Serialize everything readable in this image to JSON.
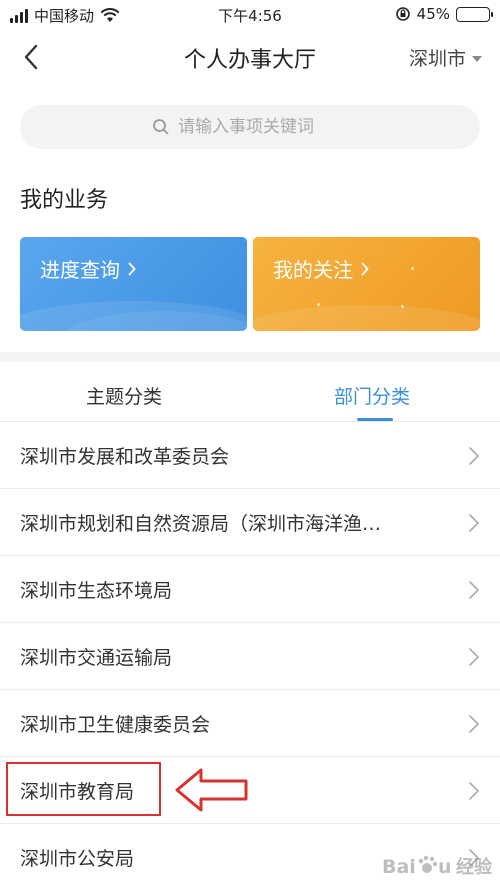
{
  "status_bar": {
    "carrier": "中国移动",
    "time": "下午4:56",
    "battery": "45%",
    "battery_level": 0.45
  },
  "nav": {
    "title": "个人办事大厅",
    "city": "深圳市"
  },
  "search": {
    "placeholder": "请输入事项关键词"
  },
  "my_business": {
    "title": "我的业务",
    "cards": [
      {
        "label": "进度查询"
      },
      {
        "label": "我的关注"
      }
    ]
  },
  "tabs": [
    {
      "label": "主题分类",
      "active": false
    },
    {
      "label": "部门分类",
      "active": true
    }
  ],
  "departments": [
    {
      "label": "深圳市发展和改革委员会"
    },
    {
      "label": "深圳市规划和自然资源局（深圳市海洋渔…"
    },
    {
      "label": "深圳市生态环境局"
    },
    {
      "label": "深圳市交通运输局"
    },
    {
      "label": "深圳市卫生健康委员会"
    },
    {
      "label": "深圳市教育局"
    },
    {
      "label": "深圳市公安局"
    }
  ],
  "watermark": {
    "text": "经验"
  },
  "colors": {
    "accent_blue": "#3c8fd9",
    "card_blue": "#4a9be8",
    "card_orange": "#f2a530",
    "highlight_red": "#d9322e"
  }
}
